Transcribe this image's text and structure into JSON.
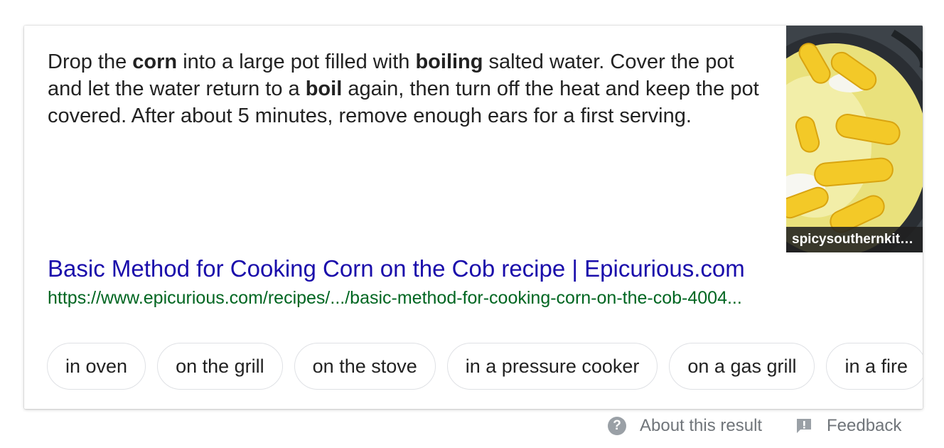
{
  "snippet": {
    "parts": [
      {
        "text": "Drop the ",
        "bold": false
      },
      {
        "text": "corn",
        "bold": true
      },
      {
        "text": " into a large pot filled with ",
        "bold": false
      },
      {
        "text": "boiling",
        "bold": true
      },
      {
        "text": " salted water. Cover the pot and let the water return to a ",
        "bold": false
      },
      {
        "text": "boil",
        "bold": true
      },
      {
        "text": " again, then turn off the heat and keep the pot covered. After about 5 minutes, remove enough ears for a first serving.",
        "bold": false
      }
    ]
  },
  "thumbnail": {
    "caption": "spicysouthernkit…"
  },
  "result": {
    "title": "Basic Method for Cooking Corn on the Cob recipe | Epicurious.com",
    "url": "https://www.epicurious.com/recipes/.../basic-method-for-cooking-corn-on-the-cob-4004..."
  },
  "chips": [
    "in oven",
    "on the grill",
    "on the stove",
    "in a pressure cooker",
    "on a gas grill",
    "in a fire"
  ],
  "footer": {
    "about_label": "About this result",
    "feedback_label": "Feedback"
  },
  "colors": {
    "link": "#1a0dab",
    "url": "#006621",
    "footer_text": "#70757a"
  },
  "icons": {
    "help": "help-circle-icon",
    "feedback": "feedback-flag-icon"
  }
}
